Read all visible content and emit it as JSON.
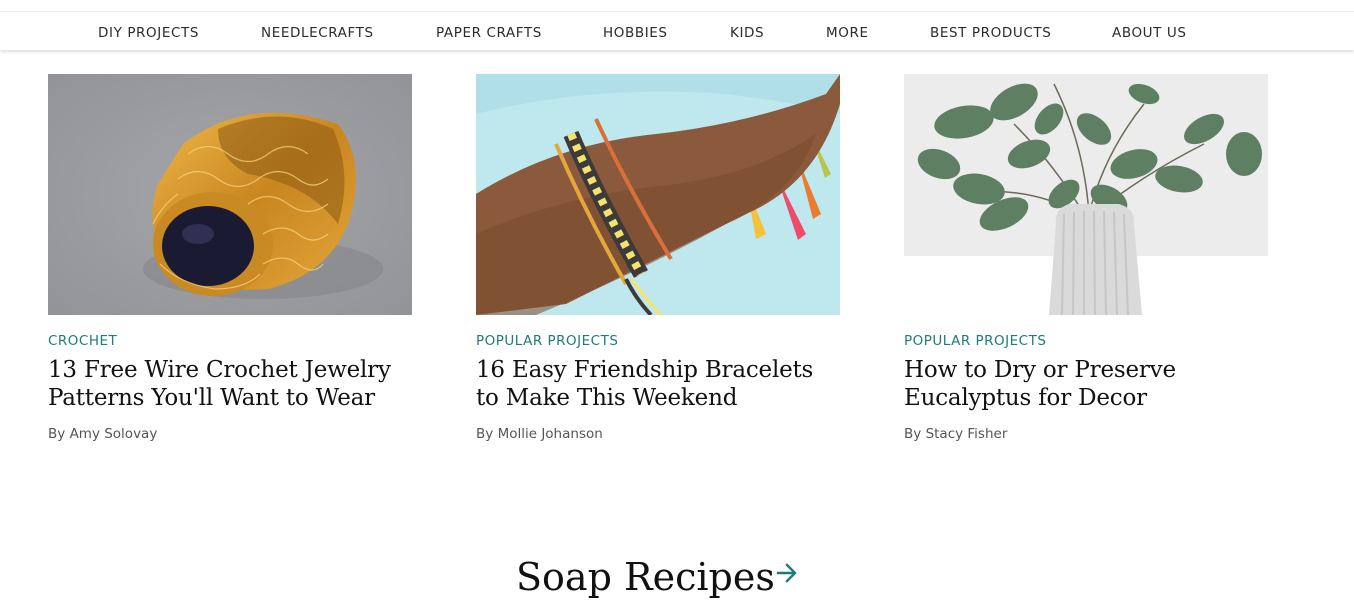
{
  "nav": {
    "items": [
      {
        "label": "DIY PROJECTS"
      },
      {
        "label": "NEEDLECRAFTS"
      },
      {
        "label": "PAPER CRAFTS"
      },
      {
        "label": "HOBBIES"
      },
      {
        "label": "KIDS"
      },
      {
        "label": "MORE"
      },
      {
        "label": "BEST PRODUCTS"
      },
      {
        "label": "ABOUT US"
      }
    ]
  },
  "cards": [
    {
      "tag": "CROCHET",
      "title": "13 Free Wire Crochet Jewelry Patterns You'll Want to Wear",
      "by": "By",
      "author": "Amy Solovay"
    },
    {
      "tag": "POPULAR PROJECTS",
      "title": "16 Easy Friendship Bracelets to Make This Weekend",
      "by": "By",
      "author": "Mollie Johanson"
    },
    {
      "tag": "POPULAR PROJECTS",
      "title": "How to Dry or Preserve Eucalyptus for Decor",
      "by": "By",
      "author": "Stacy Fisher"
    }
  ],
  "section": {
    "title": "Soap Recipes"
  },
  "colors": {
    "accent": "#1f7a7a",
    "text": "#111111",
    "nav_text": "#2b2b2b",
    "byline": "#555555"
  },
  "icons": {
    "section_arrow": "arrow-right-icon"
  }
}
